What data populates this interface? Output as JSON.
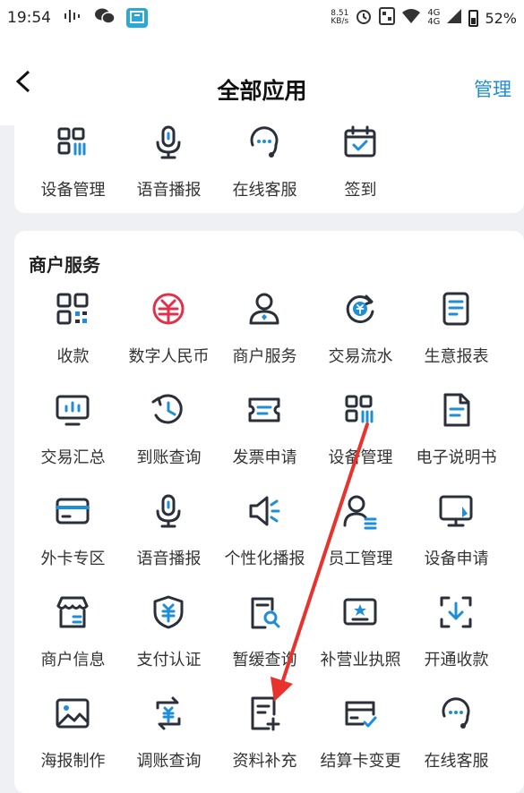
{
  "status_bar": {
    "time": "19:54",
    "network_speed_value": "8.51",
    "network_speed_unit": "KB/s",
    "signal_label_top": "4G",
    "signal_label_bottom": "4G",
    "battery": "52%"
  },
  "header": {
    "title": "全部应用",
    "action": "管理"
  },
  "top_card": {
    "items": [
      {
        "label": "设备管理",
        "icon": "device-grid-icon"
      },
      {
        "label": "语音播报",
        "icon": "microphone-icon"
      },
      {
        "label": "在线客服",
        "icon": "customer-service-icon"
      },
      {
        "label": "签到",
        "icon": "calendar-check-icon"
      }
    ]
  },
  "merchant_section": {
    "title": "商户服务",
    "items": [
      {
        "label": "收款",
        "icon": "qr-code-icon"
      },
      {
        "label": "数字人民币",
        "icon": "digital-rmb-icon"
      },
      {
        "label": "商户服务",
        "icon": "user-icon"
      },
      {
        "label": "交易流水",
        "icon": "yuan-cycle-icon"
      },
      {
        "label": "生意报表",
        "icon": "report-icon"
      },
      {
        "label": "交易汇总",
        "icon": "monitor-chart-icon"
      },
      {
        "label": "到账查询",
        "icon": "clock-refresh-icon"
      },
      {
        "label": "发票申请",
        "icon": "ticket-icon"
      },
      {
        "label": "设备管理",
        "icon": "device-grid-icon"
      },
      {
        "label": "电子说明书",
        "icon": "document-icon"
      },
      {
        "label": "外卡专区",
        "icon": "card-icon"
      },
      {
        "label": "语音播报",
        "icon": "microphone-icon"
      },
      {
        "label": "个性化播报",
        "icon": "speaker-icon"
      },
      {
        "label": "员工管理",
        "icon": "staff-icon"
      },
      {
        "label": "设备申请",
        "icon": "terminal-icon"
      },
      {
        "label": "商户信息",
        "icon": "store-icon"
      },
      {
        "label": "支付认证",
        "icon": "shield-yuan-icon"
      },
      {
        "label": "暂缓查询",
        "icon": "doc-search-icon"
      },
      {
        "label": "补营业执照",
        "icon": "license-icon"
      },
      {
        "label": "开通收款",
        "icon": "scan-download-icon"
      },
      {
        "label": "海报制作",
        "icon": "image-icon"
      },
      {
        "label": "调账查询",
        "icon": "exchange-yuan-icon"
      },
      {
        "label": "资料补充",
        "icon": "doc-add-icon"
      },
      {
        "label": "结算卡变更",
        "icon": "card-check-icon"
      },
      {
        "label": "在线客服",
        "icon": "customer-service-icon"
      }
    ]
  },
  "colors": {
    "accent": "#1e8fd6",
    "icon_dark": "#2a2f3a",
    "rmb_red": "#e0314b",
    "arrow_red": "#e8322b"
  }
}
